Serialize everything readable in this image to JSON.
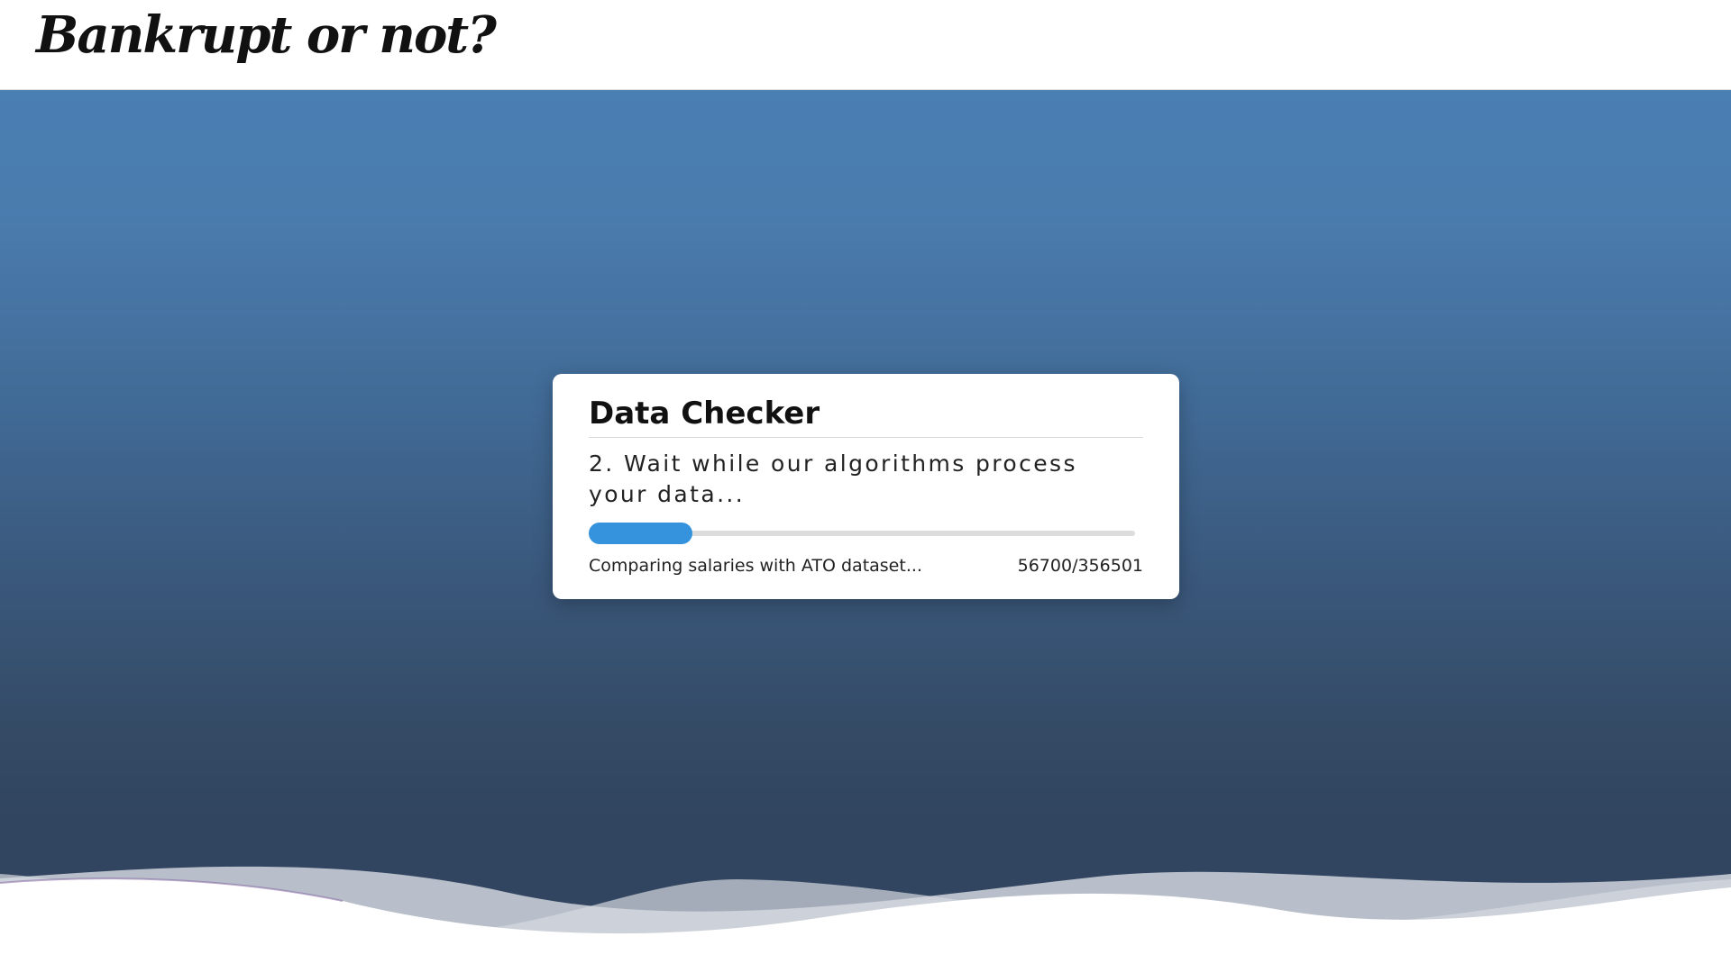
{
  "header": {
    "logo_text": "Bankrupt or not?"
  },
  "checker": {
    "title": "Data Checker",
    "step_text": "2. Wait while our algorithms process your data...",
    "status_text": "Comparing salaries with ATO dataset...",
    "counter_text": "56700/356501",
    "processed": 56700,
    "total": 356501,
    "progress_fraction": 0.19
  },
  "colors": {
    "progress_fill": "#3493dc",
    "progress_track": "#dddddd",
    "hero_top": "#4a7fb3",
    "hero_bottom": "#314560",
    "wave_accent": "#6b4f8a"
  }
}
